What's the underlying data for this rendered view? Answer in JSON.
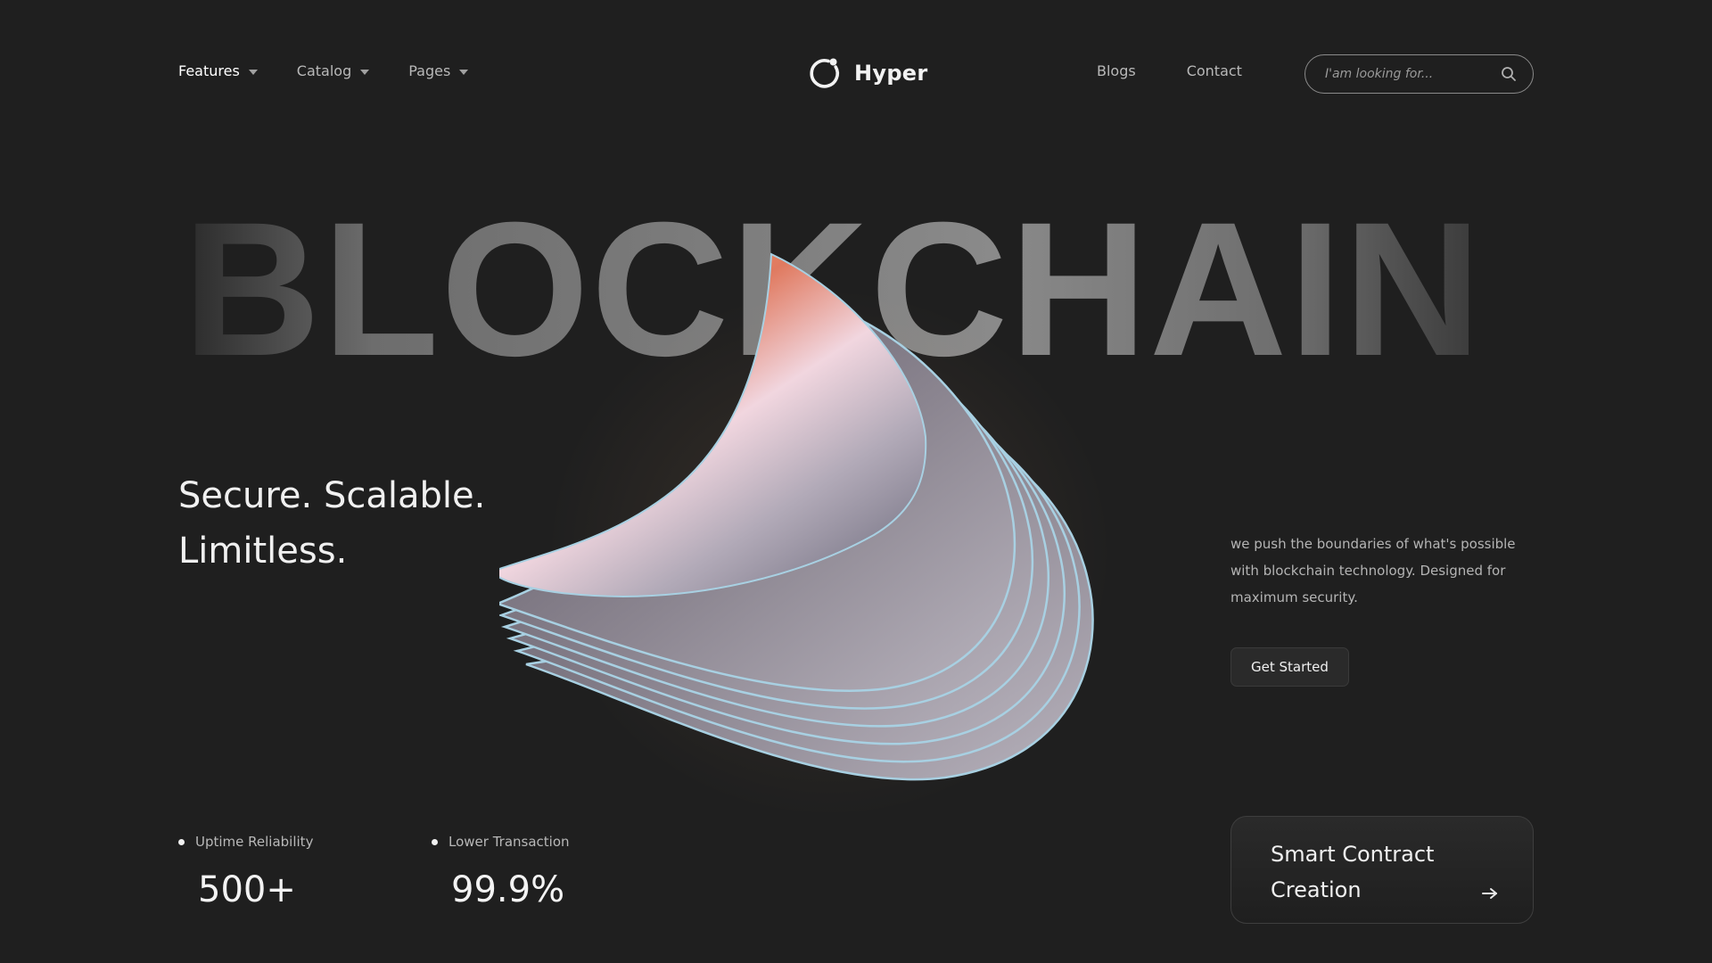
{
  "nav": {
    "left": [
      {
        "label": "Features",
        "active": true
      },
      {
        "label": "Catalog",
        "active": false
      },
      {
        "label": "Pages",
        "active": false
      }
    ],
    "brand": "Hyper",
    "right": [
      {
        "label": "Blogs"
      },
      {
        "label": "Contact"
      }
    ],
    "search_placeholder": "I'am looking for..."
  },
  "hero": {
    "big_word": "BLOCKCHAIN",
    "headline_line1": "Secure. Scalable.",
    "headline_line2": "Limitless.",
    "description": "we push the boundaries of what's possible with blockchain technology. Designed for maximum security.",
    "cta_label": "Get Started"
  },
  "stats": [
    {
      "label": "Uptime Reliability",
      "value": "500+"
    },
    {
      "label": "Lower Transaction",
      "value": "99.9%"
    }
  ],
  "card": {
    "title": "Smart Contract Creation",
    "icon": "arrow-right-icon"
  },
  "colors": {
    "background": "#1f1f1f",
    "accent_warm": "#f49a5c",
    "text_primary": "#f0f0f0"
  }
}
